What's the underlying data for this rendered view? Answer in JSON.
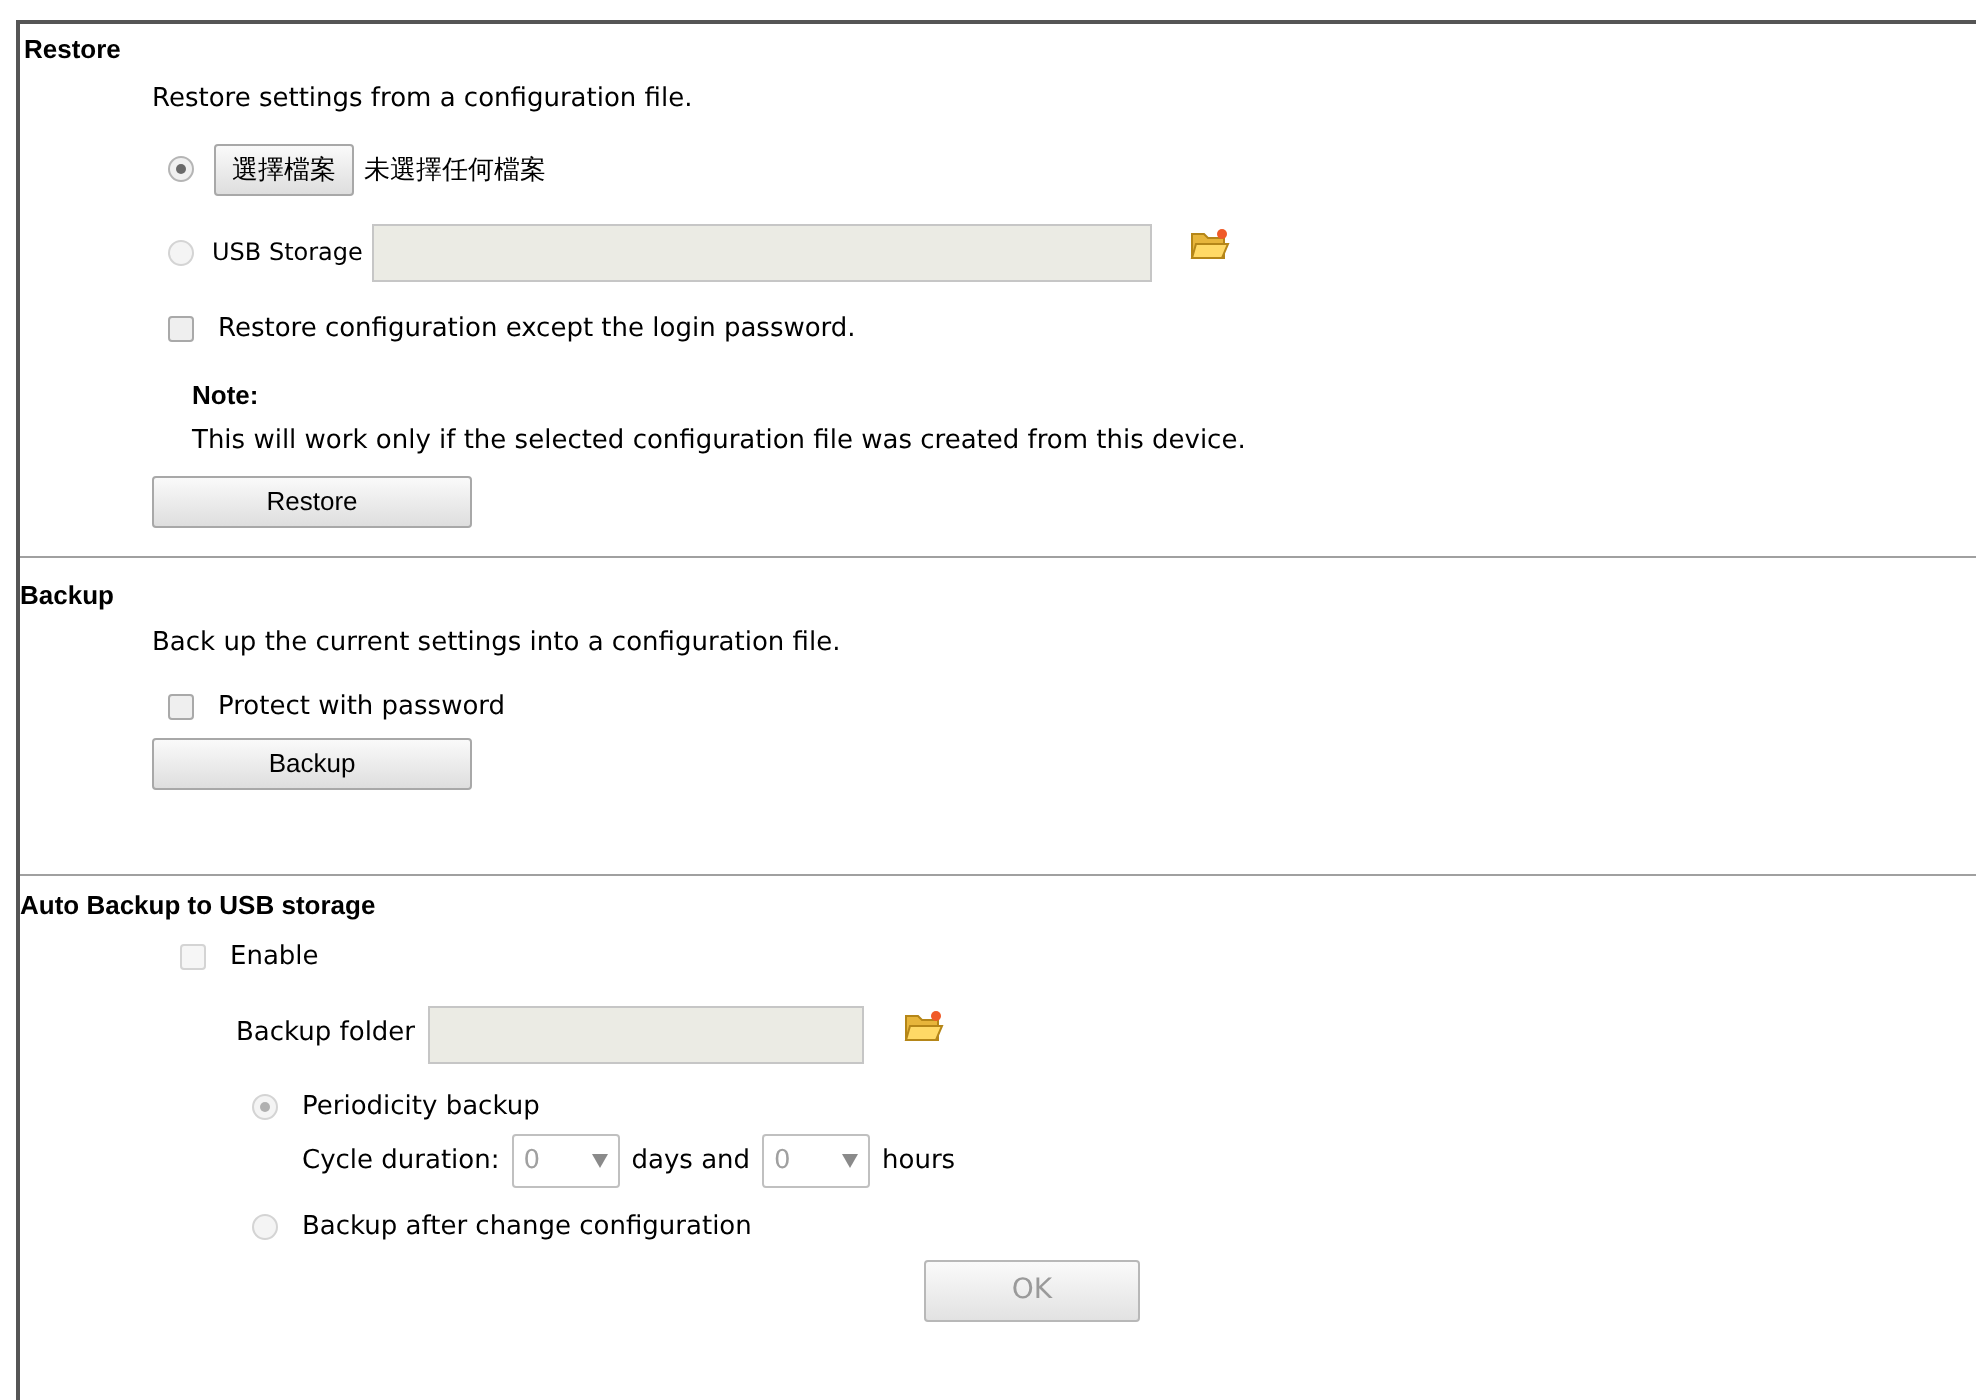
{
  "restore": {
    "title": "Restore",
    "description": "Restore settings from a configuration file.",
    "sources": [
      {
        "kind": "file",
        "selected": true,
        "button": "選擇檔案",
        "status": "未選擇任何檔案"
      },
      {
        "kind": "usb",
        "selected": false,
        "label": "USB Storage",
        "value_field": {
          "disabled": true
        }
      }
    ],
    "except_password": {
      "label": "Restore configuration except the login password.",
      "checked": false
    },
    "note": {
      "title": "Note:",
      "text": "This will work only if the selected configuration file was created from this device."
    },
    "button": "Restore"
  },
  "backup": {
    "title": "Backup",
    "description": "Back up the current settings into a configuration file.",
    "protect": {
      "label": "Protect with password",
      "checked": false
    },
    "button": "Backup"
  },
  "auto_backup": {
    "title": "Auto Backup to USB storage",
    "enable": {
      "label": "Enable",
      "checked": false,
      "disabled": true
    },
    "folder": {
      "label": "Backup folder",
      "disabled": true
    },
    "modes": [
      {
        "kind": "periodic",
        "label": "Periodicity backup",
        "selected": true,
        "disabled": true,
        "cycle_label": "Cycle duration:",
        "days": "0",
        "days_label": "days and",
        "hours": "0",
        "hours_label": "hours"
      },
      {
        "kind": "on_change",
        "label": "Backup after change configuration",
        "selected": false,
        "disabled": true
      }
    ],
    "ok": {
      "label": "OK",
      "disabled": true
    }
  }
}
